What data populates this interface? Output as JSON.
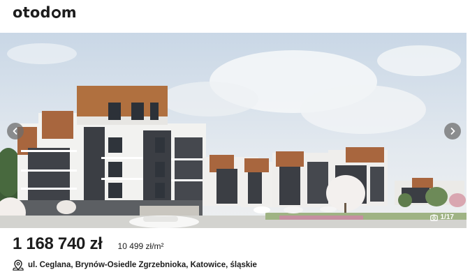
{
  "brand": {
    "logo_text_start": "otod",
    "logo_text_end": "m"
  },
  "gallery": {
    "counter": "1/17",
    "prev_icon": "chevron-left-icon",
    "next_icon": "chevron-right-icon",
    "photo_icon": "camera-icon"
  },
  "listing": {
    "price": "1 168 740 zł",
    "price_per_m2": "10 499 zł/m²",
    "address": "ul. Ceglana, Brynów-Osiedle Zgrzebnioka, Katowice, śląskie"
  },
  "colors": {
    "accent": "#1c1c1c",
    "facade_wood": "#a8663e",
    "facade_dark": "#3b3e44"
  }
}
